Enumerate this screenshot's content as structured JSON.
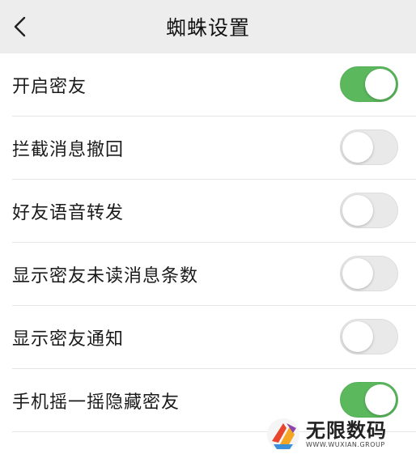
{
  "header": {
    "title": "蜘蛛设置",
    "back_icon": "chevron-left-icon"
  },
  "settings": [
    {
      "label": "开启密友",
      "enabled": true
    },
    {
      "label": "拦截消息撤回",
      "enabled": false
    },
    {
      "label": "好友语音转发",
      "enabled": false
    },
    {
      "label": "显示密友未读消息条数",
      "enabled": false
    },
    {
      "label": "显示密友通知",
      "enabled": false
    },
    {
      "label": "手机摇一摇隐藏密友",
      "enabled": true
    }
  ],
  "watermark": {
    "title": "无限数码",
    "subtitle": "WWW.WUXIAN.GROUP"
  },
  "colors": {
    "toggle_on": "#5bb85d",
    "toggle_off": "#e9e9e9",
    "header_bg": "#ededed"
  }
}
